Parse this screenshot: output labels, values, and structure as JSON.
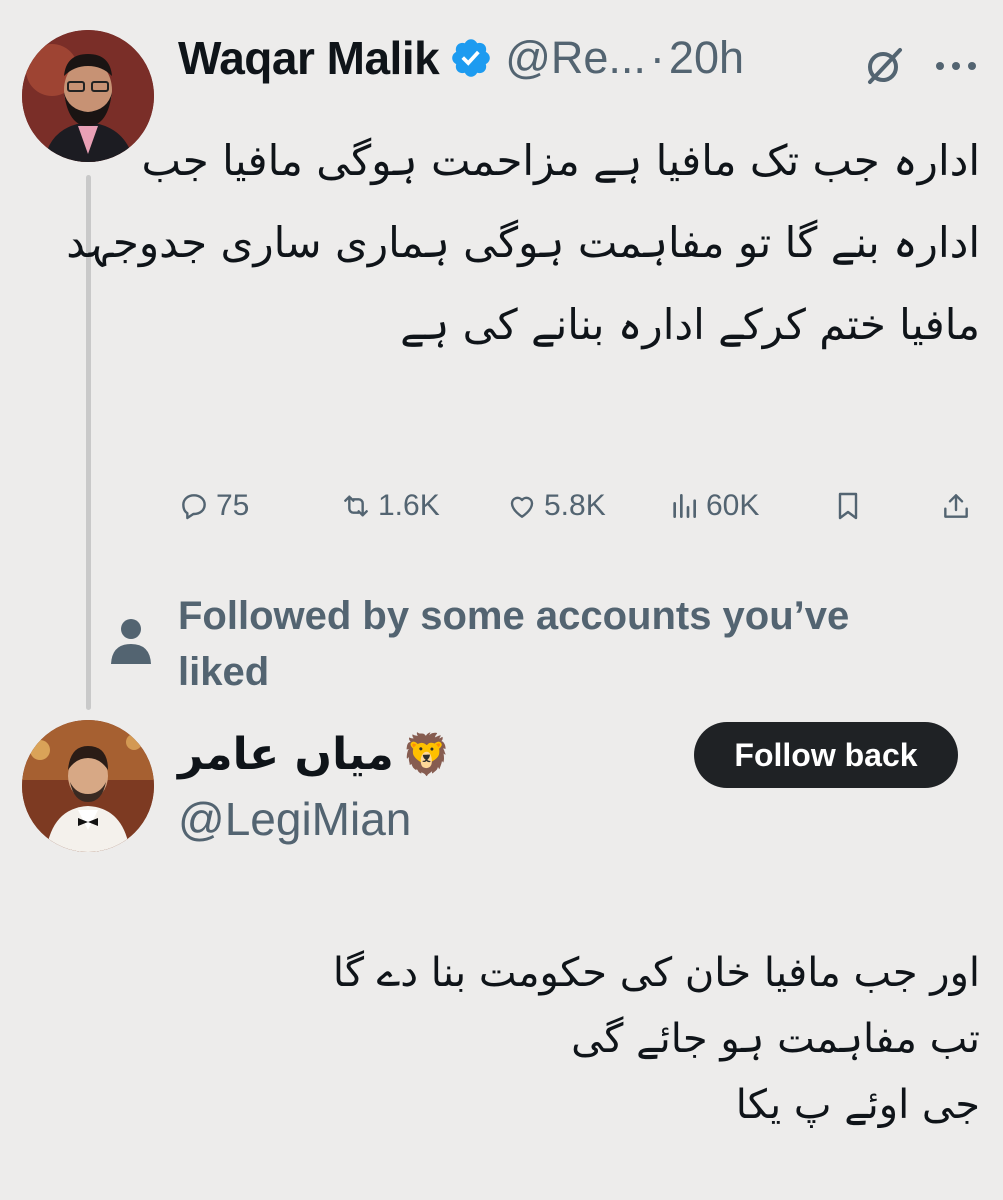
{
  "tweet": {
    "author": {
      "display_name": "Waqar Malik",
      "handle": "@Re...",
      "verified": true,
      "avatar_icon": "profile-photo"
    },
    "separator": "·",
    "time": "20h",
    "text_lines": [
      "ادارہ جب تک مافیا ہے مزاحمت ہوگی مافیا جب",
      "ادارہ بنے گا تو مفاہمت ہوگی ہماری ساری جدوجہد",
      "مافیا ختم کرکے ادارہ بنانے کی ہے"
    ],
    "stats": {
      "replies": "75",
      "reposts": "1.6K",
      "likes": "5.8K",
      "views": "60K"
    }
  },
  "social_context": {
    "text": "Followed by some accounts you’ve liked",
    "icon": "person-icon"
  },
  "reply": {
    "author": {
      "display_name": "میاں عامر",
      "emoji": "🦁",
      "handle": "@LegiMian",
      "avatar_icon": "profile-photo"
    },
    "follow_button_label": "Follow back",
    "text_lines": [
      "اور جب مافیا خان کی حکومت بنا دے گا",
      "تب مفاہمت ہو جائے گی",
      "جی اوئے پ یکا"
    ]
  },
  "colors": {
    "background": "#edeceb",
    "text": "#0f1419",
    "secondary": "#536471",
    "verified": "#1d9bf0",
    "button": "#1f2225"
  }
}
